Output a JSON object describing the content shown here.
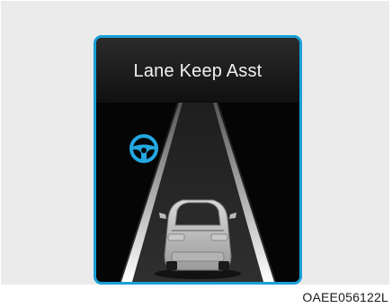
{
  "display": {
    "title": "Lane Keep Asst",
    "frame_color": "#1aa0d8",
    "icon": "steering-wheel-icon",
    "icon_color": "#23a8e2"
  },
  "caption": {
    "code": "OAEE056122L"
  }
}
